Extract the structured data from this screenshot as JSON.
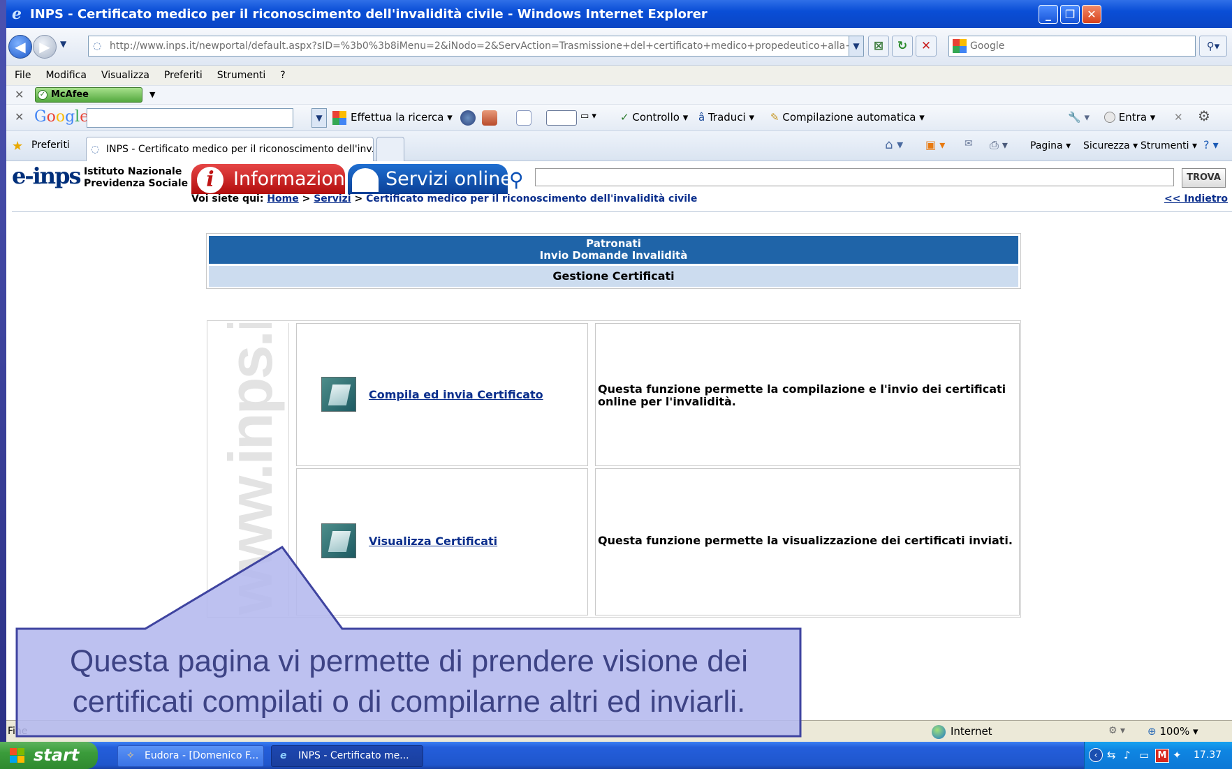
{
  "window": {
    "title": "INPS - Certificato medico per il riconoscimento dell'invalidità civile - Windows Internet Explorer"
  },
  "address_bar": {
    "url": "http://www.inps.it/newportal/default.aspx?sID=%3b0%3b8iMenu=2&iNodo=2&ServAction=Trasmissione+del+certificato+medico+propedeutico+alla+richiest",
    "search_placeholder": "Google"
  },
  "menu": [
    "File",
    "Modifica",
    "Visualizza",
    "Preferiti",
    "Strumenti",
    "?"
  ],
  "mcafee": {
    "label": "McAfee SiteAdvisor"
  },
  "google_toolbar": {
    "logo": "Google",
    "search_label": "Effettua la ricerca",
    "spell_label": "Controllo",
    "translate_label": "Traduci",
    "autofill_label": "Compilazione automatica",
    "signin_label": "Entra"
  },
  "favorites_bar": {
    "favorites_label": "Preferiti",
    "tab_title": "INPS - Certificato medico per il riconoscimento dell'inv...",
    "commands": {
      "page": "Pagina",
      "safety": "Sicurezza",
      "tools": "Strumenti"
    }
  },
  "site": {
    "logo": "e-inps",
    "institute_line1": "Istituto Nazionale",
    "institute_line2": "Previdenza Sociale",
    "tab_info": "Informazioni",
    "tab_services": "Servizi online",
    "search_button": "TROVA",
    "breadcrumb": {
      "prefix": "Voi siete qui:",
      "home": "Home",
      "services": "Servizi",
      "current": "Certificato medico per il riconoscimento dell'invalidità civile"
    },
    "back_link": "<< Indietro"
  },
  "header_panel": {
    "line1": "Patronati",
    "line2": "Invio Domande Invalidità",
    "subtitle": "Gestione Certificati"
  },
  "watermark": "www.inps.it",
  "actions": [
    {
      "link": "Compila ed invia Certificato",
      "description": "Questa funzione permette la compilazione e l'invio dei certificati online per l'invalidità."
    },
    {
      "link": "Visualizza Certificati",
      "description": "Questa funzione permette la visualizzazione dei certificati inviati."
    }
  ],
  "status_bar": {
    "status": "Fine",
    "zone": "Internet",
    "zoom": "100%"
  },
  "taskbar": {
    "start": "start",
    "tasks": [
      "Eudora - [Domenico F...",
      "INPS - Certificato me..."
    ],
    "clock": "17.37"
  },
  "callout": {
    "text": "Questa pagina vi permette di prendere visione dei certificati compilati o di compilarne altri ed inviarli."
  },
  "colors": {
    "title_bar": "#0a4ed6",
    "header_blue": "#1f64a8",
    "header_light": "#ccdcef",
    "link": "#0a2e8c",
    "callout_fill": "#b4b8ee"
  }
}
